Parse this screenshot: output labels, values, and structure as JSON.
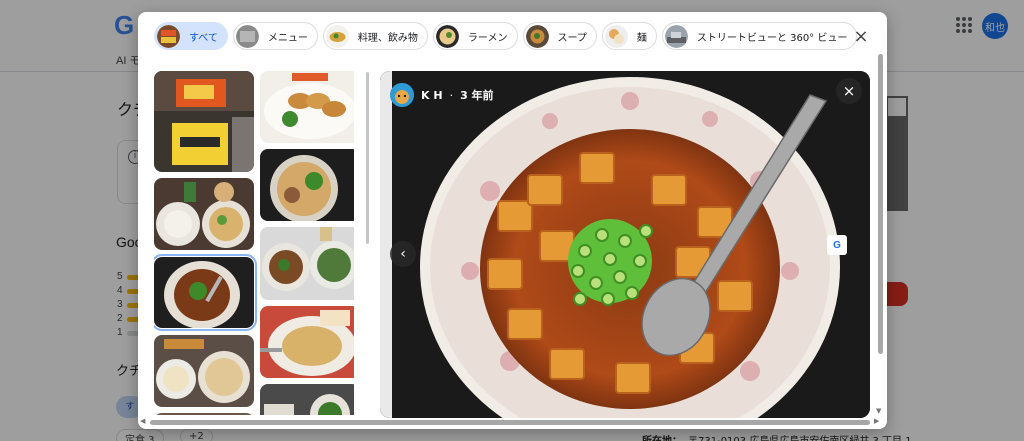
{
  "background": {
    "logo_text": "G",
    "ai_mode_label": "AI モ",
    "user_avatar": "和也",
    "title_fragment": "クチ",
    "google_fragment": "Goo",
    "rating_rows": [
      "5",
      "4",
      "3",
      "2",
      "1"
    ],
    "kuchikomi_fragment": "クチ",
    "chip_all": "す",
    "chip1": "定食 3",
    "chip2": "+2",
    "address_label": "所在地：",
    "address_value": "〒731-0103 広島県広島市安佐南区緑井 3 丁目 1"
  },
  "modal": {
    "tabs": [
      {
        "label": "すべて",
        "active": true
      },
      {
        "label": "メニュー",
        "active": false
      },
      {
        "label": "料理、飲み物",
        "active": false
      },
      {
        "label": "ラーメン",
        "active": false
      },
      {
        "label": "スープ",
        "active": false
      },
      {
        "label": "麺",
        "active": false
      },
      {
        "label": "ストリートビューと 360° ビュー",
        "active": false
      }
    ],
    "close_icon": "×",
    "viewer": {
      "author": "K H",
      "separator": "·",
      "time": "3 年前",
      "close_icon": "×",
      "prev_icon": "‹",
      "translate_icon": "G"
    },
    "thumbnails": [
      {
        "desc": "storefront",
        "selected": false
      },
      {
        "desc": "gyoza",
        "selected": false
      },
      {
        "desc": "set meal",
        "selected": false
      },
      {
        "desc": "ramen",
        "selected": false
      },
      {
        "desc": "mapo tofu",
        "selected": true
      },
      {
        "desc": "stir fry",
        "selected": false
      },
      {
        "desc": "ramen bowls",
        "selected": false
      },
      {
        "desc": "noodles",
        "selected": false
      },
      {
        "desc": "plates",
        "selected": false
      },
      {
        "desc": "dishes",
        "selected": false
      }
    ]
  },
  "colors": {
    "accent": "#0b57d0",
    "active_chip_bg": "#d3e3fd",
    "viewer_bg": "#1b1b1b"
  }
}
